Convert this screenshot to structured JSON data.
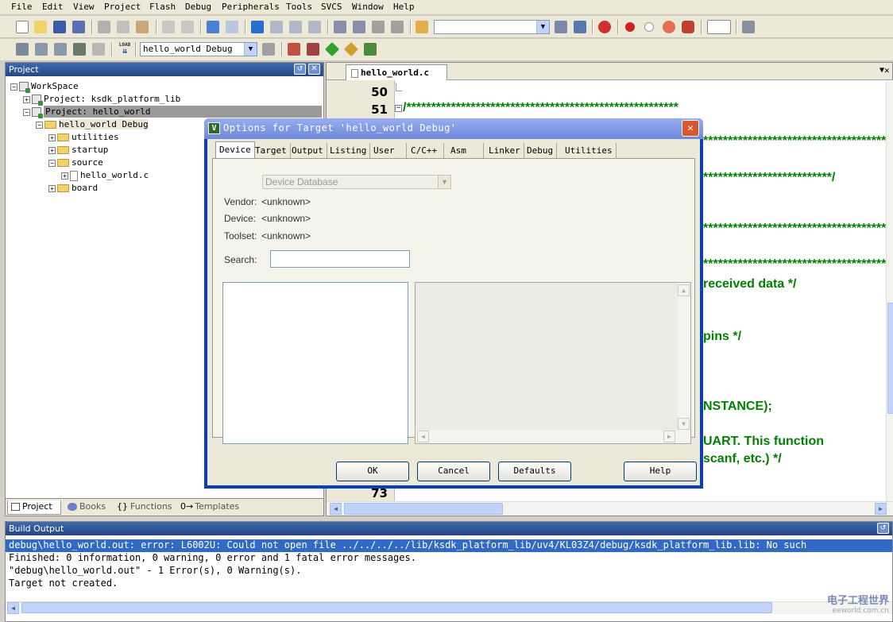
{
  "menu": [
    "File",
    "Edit",
    "View",
    "Project",
    "Flash",
    "Debug",
    "Peripherals",
    "Tools",
    "SVCS",
    "Window",
    "Help"
  ],
  "toolbar": {
    "target_select": "hello_world Debug",
    "load_label": "LOAD"
  },
  "project_panel": {
    "title": "Project",
    "tree": [
      {
        "label": "WorkSpace",
        "indent": 0,
        "icon": "workspace",
        "expander": "-"
      },
      {
        "label": "Project: ksdk_platform_lib",
        "indent": 1,
        "icon": "project",
        "expander": "+"
      },
      {
        "label": "Project: hello_world",
        "indent": 1,
        "icon": "project",
        "expander": "-",
        "selected": true
      },
      {
        "label": "hello_world Debug",
        "indent": 2,
        "icon": "folder-target",
        "expander": "-"
      },
      {
        "label": "utilities",
        "indent": 3,
        "icon": "folder",
        "expander": "+"
      },
      {
        "label": "startup",
        "indent": 3,
        "icon": "folder",
        "expander": "+"
      },
      {
        "label": "source",
        "indent": 3,
        "icon": "folder",
        "expander": "-"
      },
      {
        "label": "hello_world.c",
        "indent": 4,
        "icon": "file",
        "expander": "+"
      },
      {
        "label": "board",
        "indent": 3,
        "icon": "folder",
        "expander": "+"
      }
    ],
    "tabs": [
      "Project",
      "Books",
      "Functions",
      "Templates"
    ]
  },
  "editor": {
    "tab": "hello_world.c",
    "line_top": [
      "50",
      "51"
    ],
    "line_bottom": "73",
    "code_lines": [
      "/*******************************************************",
      "*****************************************",
      "**************************/",
      "*****************************************",
      "*****************************************",
      "received data */",
      "pins */",
      "NSTANCE);",
      "UART.  This function",
      " scanf, etc.) */"
    ]
  },
  "build": {
    "title": "Build Output",
    "lines": [
      "debug\\hello_world.out: error: L6002U: Could not open file ../../../../lib/ksdk_platform_lib/uv4/KL03Z4/debug/ksdk_platform_lib.lib: No such",
      "Finished: 0 information, 0 warning, 0 error and 1 fatal error messages.",
      "\"debug\\hello_world.out\" - 1 Error(s), 0 Warning(s).",
      "Target not created."
    ]
  },
  "dialog": {
    "title": "Options for Target 'hello_world Debug'",
    "tabs": [
      "Device",
      "Target",
      "Output",
      "Listing",
      "User",
      "C/C++",
      "Asm",
      "Linker",
      "Debug",
      "Utilities"
    ],
    "database_select": "Device Database",
    "vendor_label": "Vendor:",
    "vendor_value": "<unknown>",
    "device_label": "Device:",
    "device_value": "<unknown>",
    "toolset_label": "Toolset:",
    "toolset_value": "<unknown>",
    "search_label": "Search:",
    "search_value": "",
    "buttons": {
      "ok": "OK",
      "cancel": "Cancel",
      "defaults": "Defaults",
      "help": "Help"
    }
  },
  "watermark": {
    "cn": "电子工程世界",
    "url": "eeworld.com.cn"
  },
  "colors": {
    "title_blue": "#27477f",
    "code_green": "#008000",
    "selection_blue": "#316ac5",
    "dialog_frame": "#0a3ec1"
  }
}
